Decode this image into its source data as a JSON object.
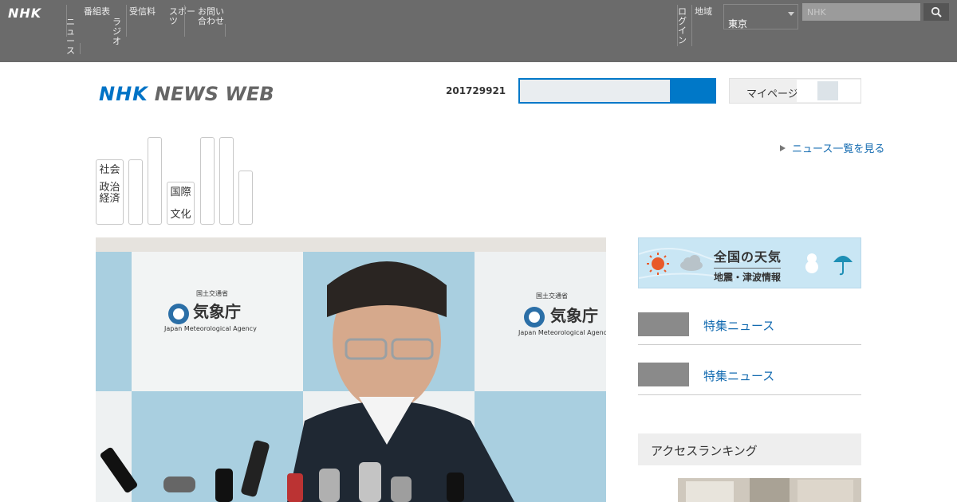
{
  "topbar": {
    "logo": "NHK",
    "nav": [
      "ニュース",
      "番組表",
      "ラジオ",
      "受信料",
      "スポーツ",
      "お問い合わせ"
    ],
    "account_label": "ログイン",
    "region_label": "地域",
    "region_value": "東京",
    "search_placeholder": "NHK"
  },
  "header": {
    "brand_nhk": "NHK",
    "brand_title": "NEWS WEB",
    "date": "201729921",
    "search_value": "",
    "mymenu_label": "マイページ"
  },
  "categories": [
    {
      "line1": "社会",
      "line2": "政治",
      "line3": "経済"
    },
    {
      "line1": "",
      "line2": "",
      "line3": ""
    },
    {
      "line1": "",
      "line2": "",
      "line3": ""
    },
    {
      "line1": "国際",
      "line2": "文化",
      "line3": ""
    },
    {
      "line1": "",
      "line2": "",
      "line3": ""
    },
    {
      "line1": "",
      "line2": "",
      "line3": ""
    },
    {
      "line1": "",
      "line2": "",
      "line3": ""
    }
  ],
  "more_link": "ニュース一覧を見る",
  "hero": {
    "agency_small": "国土交通省",
    "agency_name": "気象庁",
    "agency_en": "Japan Meteorological Agency"
  },
  "sidebar": {
    "weather_title": "全国の天気",
    "weather_sub": "地震・津波情報",
    "items": [
      {
        "text": "特集ニュース"
      },
      {
        "text": "特集ニュース"
      }
    ],
    "ranking_title": "アクセスランキング"
  },
  "colors": {
    "topbar": "#6b6b6b",
    "brand_blue": "#0073c6",
    "link_blue": "#126ab0",
    "search_blue": "#0078c8"
  }
}
